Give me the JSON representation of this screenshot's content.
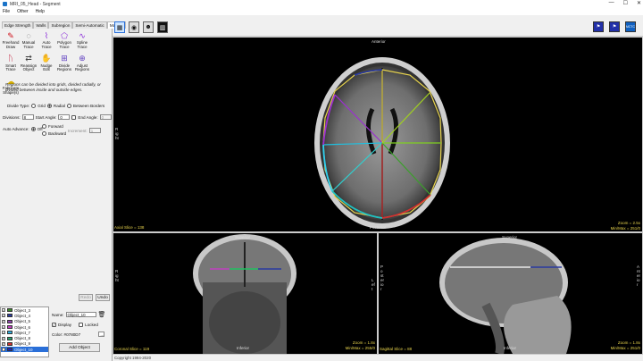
{
  "window": {
    "title": "MRI_05_Head - Segment",
    "controls": [
      "—",
      "☐",
      "✕"
    ]
  },
  "menu": [
    "File",
    "Other",
    "Help"
  ],
  "tabs": [
    "Edge Strength",
    "Walls",
    "Subregion",
    "Semi-Automatic",
    "Manual"
  ],
  "view_tools": [
    "layout-icon",
    "brain-icon",
    "head-icon",
    "grid-icon"
  ],
  "right_tools": [
    "flag-icon",
    "flag2-icon",
    "mctc-icon"
  ],
  "right_tool_labels": [
    "",
    "",
    "MCTC"
  ],
  "tools": [
    {
      "name": "freehand-draw",
      "label": "Freehand Draw",
      "icon": "✎",
      "color": "#d0101a"
    },
    {
      "name": "manual-trace",
      "label": "Manual Trace",
      "icon": "◌",
      "color": "#444"
    },
    {
      "name": "auto-trace",
      "label": "Auto Trace",
      "icon": "⌇",
      "color": "#8a2bd8"
    },
    {
      "name": "polygon-trace",
      "label": "Polygon Trace",
      "icon": "⬠",
      "color": "#8a2bd8"
    },
    {
      "name": "spline-trace",
      "label": "Spline Trace",
      "icon": "∿",
      "color": "#8a2bd8"
    },
    {
      "name": "smart-trace",
      "label": "Smart Trace",
      "icon": "ᚢ",
      "color": "#c01030"
    },
    {
      "name": "reassign-object",
      "label": "Reassign Object",
      "icon": "⇄",
      "color": "#444"
    },
    {
      "name": "nudge-edit",
      "label": "Nudge Edit",
      "icon": "✋",
      "color": "#aa3344"
    },
    {
      "name": "divide-regions",
      "label": "Divide Regions",
      "icon": "⊞",
      "color": "#6040c0"
    },
    {
      "name": "adjust-regions",
      "label": "Adjust Regions",
      "icon": "⊕",
      "color": "#6040c0"
    },
    {
      "name": "fabricate-shapes",
      "label": "Fabricate Shape(s)",
      "icon": "☁",
      "color": "#d8b000"
    }
  ],
  "help_text": "Regions can be divided into grids, divided radially, or divided between inside and outside edges.",
  "divide_type": {
    "label": "Divide Type:",
    "options": [
      "Grid",
      "Radial",
      "Between Borders"
    ],
    "selected": "Radial"
  },
  "divisions": {
    "label": "Divisions:",
    "value": "8",
    "start_label": "Start Angle:",
    "start_value": "0",
    "end_label": "End Angle:",
    "end_value": "0"
  },
  "auto_advance": {
    "label": "Auto Advance:",
    "off": "Off",
    "forward": "Forward",
    "backward": "Backward",
    "increment_label": "Increment:",
    "increment_value": "1"
  },
  "buttons": {
    "undo": "Undo",
    "redo": "Redo",
    "add_object": "Add Object"
  },
  "objects": [
    {
      "name": "Object_3",
      "color": "#3a8a2a"
    },
    {
      "name": "Object_4",
      "color": "#2a3aa0"
    },
    {
      "name": "Object_5",
      "color": "#8e44ad"
    },
    {
      "name": "Object_6",
      "color": "#c040c0"
    },
    {
      "name": "Object_7",
      "color": "#30b0e0"
    },
    {
      "name": "Object_8",
      "color": "#2aa070"
    },
    {
      "name": "Object_9",
      "color": "#d03030"
    },
    {
      "name": "Object_10",
      "color": "#2020c0",
      "selected": true
    }
  ],
  "object_panel": {
    "name_label": "Name:",
    "name_value": "Object_10",
    "display_label": "Display",
    "locked_label": "Locked",
    "color_label": "Color: #0780D7"
  },
  "axial": {
    "top": "Anterior",
    "bottom": "Posterior",
    "left": "Right",
    "slice": "Axial Slice = 138",
    "zoom": "Zoom = 2.5x",
    "minmax": "Min/Max = 251/0"
  },
  "coronal": {
    "top": "Superior",
    "bottom": "Inferior",
    "left": "Right",
    "right": "Left",
    "slice": "Coronal Slice = 119",
    "zoom": "Zoom = 1.8x",
    "minmax": "Min/Max = 255/0"
  },
  "sagittal": {
    "top": "Superior",
    "bottom": "Inferior",
    "left": "Posterior",
    "right": "Anterior",
    "slice": "Sagittal Slice = 88",
    "zoom": "Zoom = 1.8x",
    "minmax": "Min/Max = 251/0"
  },
  "status": "Copyright 1994-2020",
  "tool_icons": [
    "freehand-icon",
    "manual-trace-icon",
    "auto-trace-icon",
    "polygon-icon",
    "spline-icon",
    "smart-trace-icon",
    "reassign-icon",
    "nudge-icon",
    "divide-icon",
    "adjust-icon",
    "fabricate-icon"
  ]
}
